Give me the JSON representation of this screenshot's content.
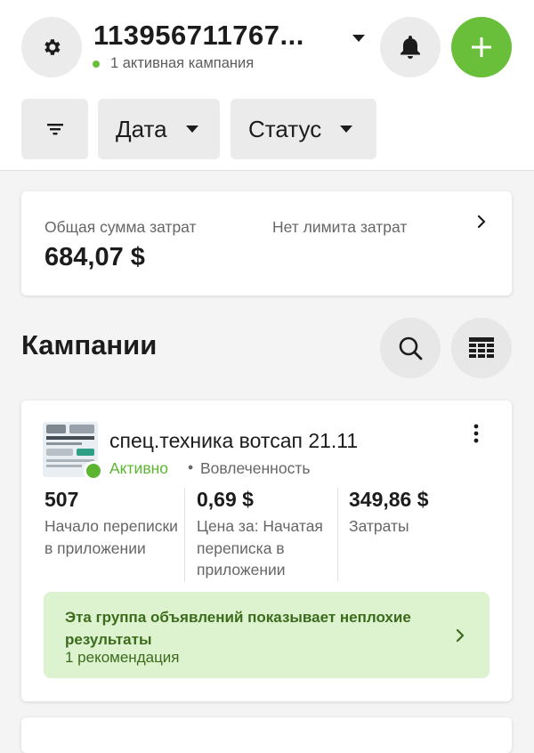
{
  "header": {
    "account_name": "113956711767...",
    "account_subtitle": "1 активная кампания"
  },
  "filters": {
    "date_label": "Дата",
    "status_label": "Статус"
  },
  "spend_summary": {
    "label": "Общая сумма затрат",
    "amount": "684,07 $",
    "limit_text": "Нет лимита затрат"
  },
  "campaigns_section": {
    "title": "Кампании"
  },
  "campaign": {
    "name": "спец.техника вотсап 21.11",
    "status": "Активно",
    "separator": "•",
    "objective": "Вовлеченность",
    "metrics": [
      {
        "value": "507",
        "label": "Начало переписки в приложении"
      },
      {
        "value": "0,69 $",
        "label": "Цена за: Начатая переписка в приложении"
      },
      {
        "value": "349,86 $",
        "label": "Затраты"
      }
    ],
    "recommendation": {
      "title": "Эта группа объявлений показывает неплохие результаты",
      "count": "1 рекомендация"
    }
  },
  "colors": {
    "accent_green": "#6abf3a",
    "active_green": "#5cb531",
    "reco_bg": "#ddf2cf",
    "reco_text": "#3c6b1c"
  },
  "icons": [
    "gear-icon",
    "caret-down-icon",
    "bell-icon",
    "plus-icon",
    "filter-icon",
    "chevron-right-icon",
    "search-icon",
    "table-icon",
    "more-vertical-icon"
  ]
}
